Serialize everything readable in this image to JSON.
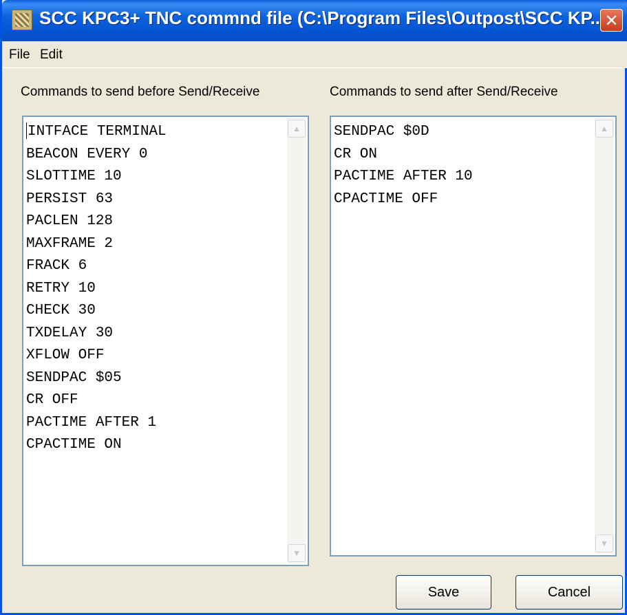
{
  "window": {
    "title": "SCC KPC3+ TNC commnd file (C:\\Program Files\\Outpost\\SCC KP...",
    "close_icon": "close-icon",
    "app_icon": "tnc-app-icon"
  },
  "menu": {
    "items": [
      "File",
      "Edit"
    ]
  },
  "before": {
    "label": "Commands to send before Send/Receive",
    "text": "INTFACE TERMINAL\nBEACON EVERY 0\nSLOTTIME 10\nPERSIST 63\nPACLEN 128\nMAXFRAME 2\nFRACK 6\nRETRY 10\nCHECK 30\nTXDELAY 30\nXFLOW OFF\nSENDPAC $05\nCR OFF\nPACTIME AFTER 1\nCPACTIME ON"
  },
  "after": {
    "label": "Commands to send after Send/Receive",
    "text": "SENDPAC $0D\nCR ON\nPACTIME AFTER 10\nCPACTIME OFF"
  },
  "buttons": {
    "save": "Save",
    "cancel": "Cancel"
  }
}
